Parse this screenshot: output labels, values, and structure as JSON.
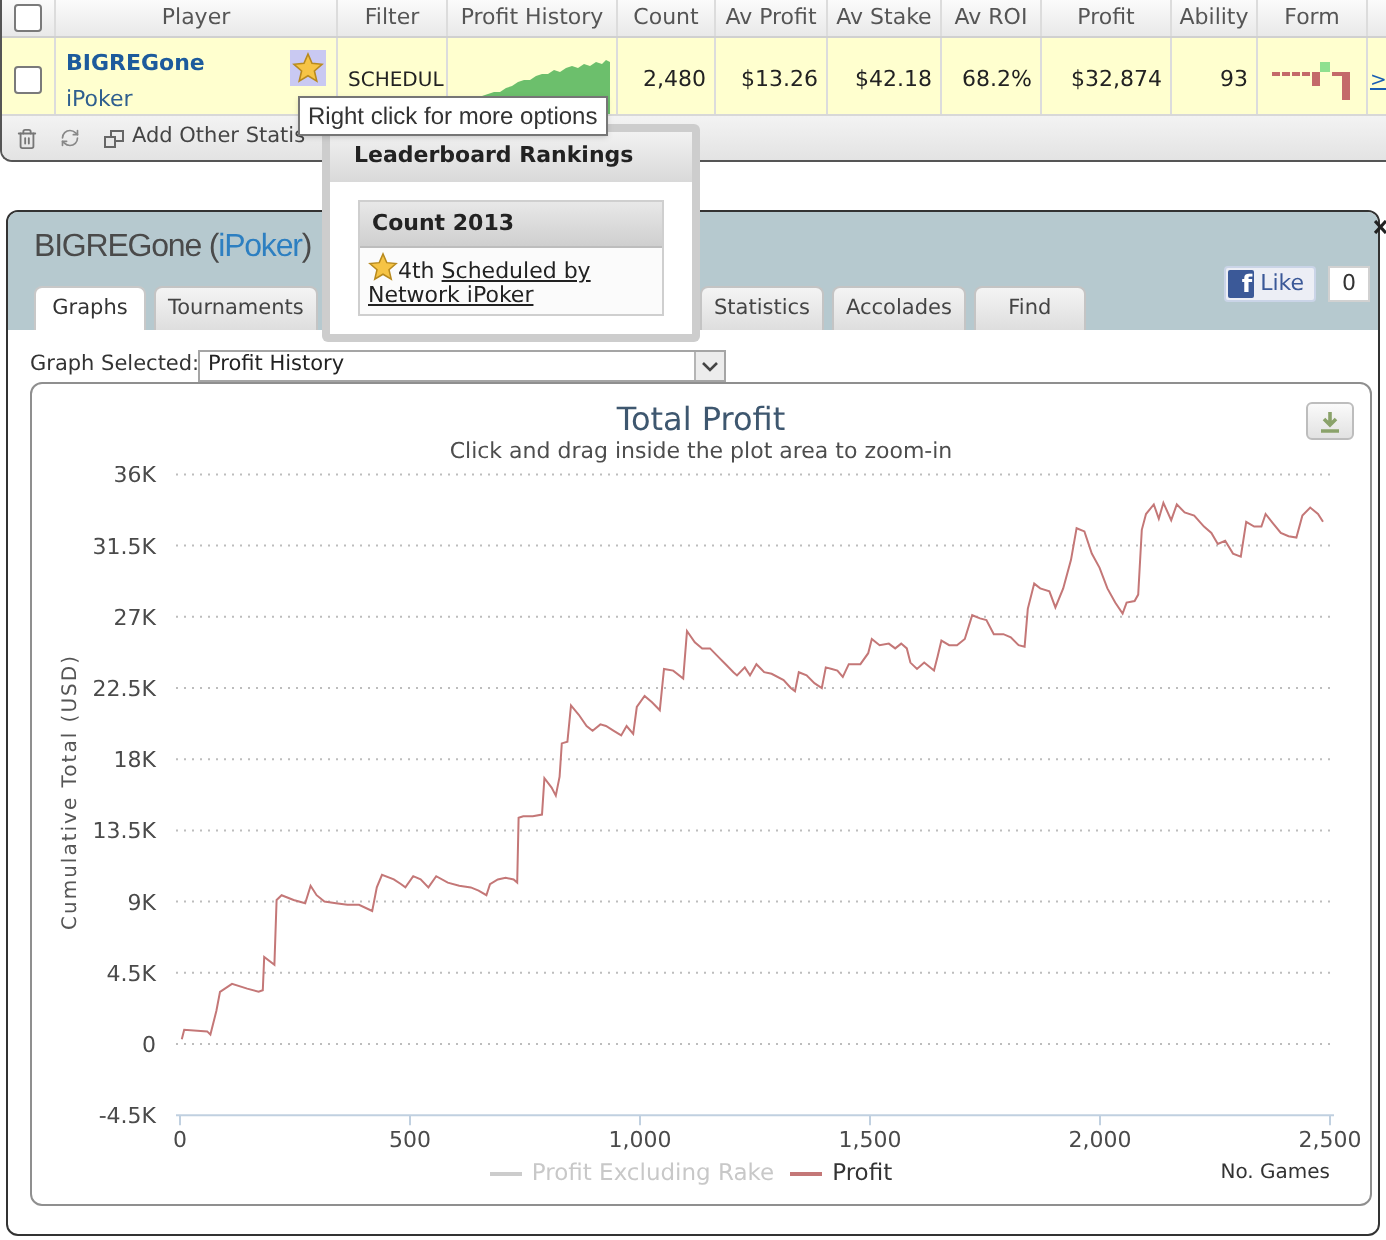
{
  "players_table": {
    "select_all": {
      "checked": false
    },
    "columns": [
      "Player",
      "Filter",
      "Profit History",
      "Count",
      "Av Profit",
      "Av Stake",
      "Av ROI",
      "Profit",
      "Ability",
      "Form"
    ],
    "rows": [
      {
        "checked": false,
        "player": "BIGREGone",
        "network": "iPoker",
        "filter": "SCHEDUL",
        "count": "2,480",
        "av_profit": "$13.26",
        "av_stake": "$42.18",
        "av_roi": "68.2%",
        "profit": "$32,874",
        "ability": "93",
        "link": ">"
      }
    ],
    "toolbar": {
      "action": "Add Other Statis"
    }
  },
  "tooltip": {
    "text": "Right click for more options"
  },
  "leaderboard_popup": {
    "title": "Leaderboard Rankings",
    "section": "Count 2013",
    "rank": "4th",
    "link": "Scheduled by Network iPoker"
  },
  "profile_panel": {
    "name": "BIGREGone (",
    "network": "iPoker",
    "name_end": ")",
    "like": {
      "logo": "f",
      "label": "Like",
      "count": "0"
    },
    "tabs": [
      {
        "label": "Graphs",
        "selected": true
      },
      {
        "label": "Tournaments",
        "selected": false
      },
      {
        "label": "Statistics",
        "selected": false
      },
      {
        "label": "Accolades",
        "selected": false
      },
      {
        "label": "Find",
        "selected": false
      }
    ],
    "graph_selector": {
      "label": "Graph Selected:",
      "value": "Profit History"
    },
    "chart": {
      "subtitle": "Click and drag inside the plot area to zoom-in",
      "legend": [
        {
          "hidden": true
        },
        {
          "hidden": false
        }
      ],
      "chart_data": {
        "type": "line",
        "title": "Total Profit",
        "xlabel": "No. Games",
        "ylabel": "Cumulative Total (USD)",
        "grid": true,
        "x": [
          4,
          9,
          59,
          66,
          79,
          87,
          113,
          146,
          171,
          180,
          183,
          205,
          210,
          221,
          247,
          272,
          284,
          297,
          314,
          339,
          364,
          389,
          418,
          428,
          439,
          465,
          481,
          490,
          507,
          523,
          540,
          557,
          582,
          607,
          632,
          649,
          666,
          674,
          691,
          708,
          725,
          733,
          736,
          746,
          767,
          787,
          792,
          808,
          817,
          825,
          830,
          842,
          850,
          867,
          884,
          897,
          914,
          926,
          943,
          959,
          971,
          985,
          993,
          1010,
          1026,
          1043,
          1052,
          1072,
          1094,
          1102,
          1119,
          1135,
          1152,
          1169,
          1186,
          1203,
          1211,
          1228,
          1239,
          1253,
          1270,
          1286,
          1312,
          1328,
          1337,
          1345,
          1362,
          1379,
          1395,
          1404,
          1417,
          1429,
          1441,
          1454,
          1479,
          1496,
          1504,
          1521,
          1541,
          1555,
          1568,
          1580,
          1588,
          1602,
          1618,
          1639,
          1647,
          1655,
          1672,
          1689,
          1706,
          1722,
          1739,
          1753,
          1769,
          1790,
          1806,
          1823,
          1836,
          1843,
          1857,
          1870,
          1890,
          1903,
          1920,
          1937,
          1949,
          1966,
          1982,
          1999,
          2016,
          2033,
          2049,
          2058,
          2075,
          2083,
          2091,
          2100,
          2117,
          2128,
          2138,
          2155,
          2167,
          2184,
          2205,
          2226,
          2242,
          2256,
          2272,
          2289,
          2306,
          2318,
          2335,
          2351,
          2360,
          2376,
          2393,
          2410,
          2427,
          2440,
          2457,
          2474,
          2485
        ],
        "series": [
          {
            "name": "Profit Excluding Rake",
            "values": [
              null,
              null,
              null,
              null,
              null,
              null,
              null,
              null,
              null,
              null,
              null,
              null,
              null,
              null,
              null,
              null,
              null,
              null,
              null,
              null,
              null,
              null,
              null,
              null,
              null,
              null,
              null,
              null,
              null,
              null,
              null,
              null,
              null,
              null,
              null,
              null,
              null,
              null,
              null,
              null,
              null,
              null,
              null,
              null,
              null,
              null,
              null,
              null,
              null,
              null,
              null,
              null,
              null,
              null,
              null,
              null,
              null,
              null,
              null,
              null,
              null,
              null,
              null,
              null,
              null,
              null,
              null,
              null,
              null,
              null,
              null,
              null,
              null,
              null,
              null,
              null,
              null,
              null,
              null,
              null,
              null,
              null,
              null,
              null,
              null,
              null,
              null,
              null,
              null,
              null,
              null,
              null,
              null,
              null,
              null,
              null,
              null,
              null,
              null,
              null,
              null,
              null,
              null,
              null,
              null,
              null,
              null,
              null,
              null,
              null,
              null,
              null,
              null,
              null,
              null,
              null,
              null,
              null,
              null,
              null,
              null,
              null,
              null,
              null,
              null,
              null,
              null,
              null,
              null,
              null,
              null,
              null,
              null,
              null,
              null,
              null,
              null,
              null,
              null,
              null,
              null,
              null,
              null,
              null,
              null,
              null,
              null,
              null,
              null,
              null,
              null,
              null,
              null,
              null,
              null,
              null,
              null,
              null,
              null,
              null,
              null,
              null,
              null
            ]
          },
          {
            "name": "Profit",
            "color": "#c47777",
            "values": [
              300,
              900,
              800,
              600,
              2100,
              3300,
              3800,
              3500,
              3300,
              3400,
              5500,
              5000,
              9100,
              9400,
              9100,
              8900,
              10000,
              9400,
              9000,
              8900,
              8800,
              8800,
              8400,
              9900,
              10700,
              10400,
              10100,
              9900,
              10600,
              10400,
              9900,
              10600,
              10200,
              10000,
              9900,
              9700,
              9400,
              10100,
              10400,
              10500,
              10400,
              10200,
              14300,
              14400,
              14400,
              14500,
              16800,
              16200,
              15700,
              16900,
              19000,
              19100,
              21400,
              20800,
              20100,
              19800,
              20200,
              20100,
              19800,
              19500,
              20100,
              19600,
              21300,
              22000,
              21600,
              21100,
              23700,
              23600,
              23100,
              26100,
              25400,
              25000,
              25000,
              24500,
              24000,
              23500,
              23300,
              23800,
              23300,
              24000,
              23500,
              23400,
              23000,
              22500,
              22300,
              23500,
              23300,
              22800,
              22500,
              23800,
              23700,
              23600,
              23200,
              24000,
              24000,
              24700,
              25600,
              25200,
              25300,
              25000,
              25300,
              25000,
              24100,
              23700,
              24100,
              23600,
              24500,
              25500,
              25200,
              25200,
              25600,
              27100,
              26900,
              26800,
              25900,
              25900,
              25700,
              25200,
              25100,
              27500,
              29100,
              28800,
              28600,
              27600,
              28800,
              30600,
              32600,
              32400,
              31000,
              30100,
              28800,
              27900,
              27200,
              27900,
              28000,
              28400,
              32500,
              33500,
              34100,
              33200,
              34200,
              33100,
              34100,
              33600,
              33400,
              32700,
              32300,
              31600,
              31800,
              31000,
              30800,
              33000,
              32700,
              32700,
              33500,
              32900,
              32300,
              32100,
              32000,
              33400,
              33900,
              33500,
              33000
            ]
          }
        ],
        "xlim": [
          0,
          2500
        ],
        "ylim": [
          -4500,
          36000
        ],
        "xticks": [
          {
            "value": 0,
            "label": "0"
          },
          {
            "value": 500,
            "label": "500"
          },
          {
            "value": 1000,
            "label": "1,000"
          },
          {
            "value": 1500,
            "label": "1,500"
          },
          {
            "value": 2000,
            "label": "2,000"
          },
          {
            "value": 2500,
            "label": "2,500"
          }
        ],
        "yticks": [
          {
            "value": -4500,
            "label": "-4.5K"
          },
          {
            "value": 0,
            "label": "0"
          },
          {
            "value": 4500,
            "label": "4.5K"
          },
          {
            "value": 9000,
            "label": "9K"
          },
          {
            "value": 13500,
            "label": "13.5K"
          },
          {
            "value": 18000,
            "label": "18K"
          },
          {
            "value": 22500,
            "label": "22.5K"
          },
          {
            "value": 27000,
            "label": "27K"
          },
          {
            "value": 31500,
            "label": "31.5K"
          },
          {
            "value": 36000,
            "label": "36K"
          }
        ]
      }
    }
  }
}
